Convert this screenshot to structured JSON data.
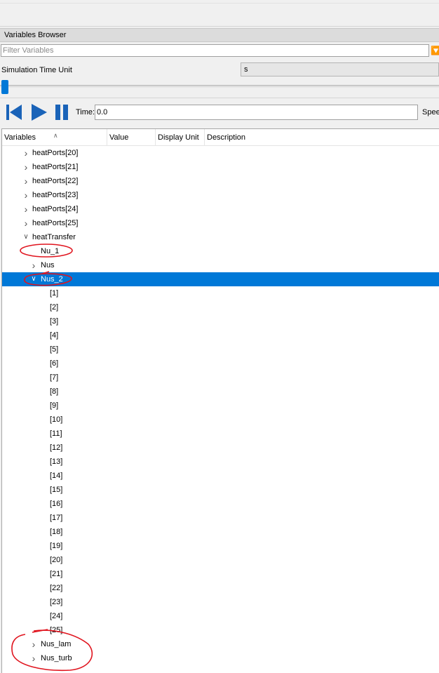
{
  "panel": {
    "title": "Variables Browser"
  },
  "filter": {
    "placeholder": "Filter Variables"
  },
  "sim_time_unit": {
    "label": "Simulation Time Unit",
    "value": "s"
  },
  "toolbar": {
    "time_label": "Time:",
    "time_value": "0.0",
    "speed_label": "Speed"
  },
  "columns": [
    "Variables",
    "Value",
    "Display Unit",
    "Description"
  ],
  "rows": [
    {
      "label": "heatPorts[20]",
      "depth": 1,
      "arrow": "collapsed"
    },
    {
      "label": "heatPorts[21]",
      "depth": 1,
      "arrow": "collapsed"
    },
    {
      "label": "heatPorts[22]",
      "depth": 1,
      "arrow": "collapsed"
    },
    {
      "label": "heatPorts[23]",
      "depth": 1,
      "arrow": "collapsed"
    },
    {
      "label": "heatPorts[24]",
      "depth": 1,
      "arrow": "collapsed"
    },
    {
      "label": "heatPorts[25]",
      "depth": 1,
      "arrow": "collapsed"
    },
    {
      "label": "heatTransfer",
      "depth": 1,
      "arrow": "expanded"
    },
    {
      "label": "Nu_1",
      "depth": 2,
      "arrow": "none"
    },
    {
      "label": "Nus",
      "depth": 2,
      "arrow": "collapsed"
    },
    {
      "label": "Nus_2",
      "depth": 2,
      "arrow": "expanded",
      "selected": true
    },
    {
      "label": "[1]",
      "depth": 3,
      "arrow": "none"
    },
    {
      "label": "[2]",
      "depth": 3,
      "arrow": "none"
    },
    {
      "label": "[3]",
      "depth": 3,
      "arrow": "none"
    },
    {
      "label": "[4]",
      "depth": 3,
      "arrow": "none"
    },
    {
      "label": "[5]",
      "depth": 3,
      "arrow": "none"
    },
    {
      "label": "[6]",
      "depth": 3,
      "arrow": "none"
    },
    {
      "label": "[7]",
      "depth": 3,
      "arrow": "none"
    },
    {
      "label": "[8]",
      "depth": 3,
      "arrow": "none"
    },
    {
      "label": "[9]",
      "depth": 3,
      "arrow": "none"
    },
    {
      "label": "[10]",
      "depth": 3,
      "arrow": "none"
    },
    {
      "label": "[11]",
      "depth": 3,
      "arrow": "none"
    },
    {
      "label": "[12]",
      "depth": 3,
      "arrow": "none"
    },
    {
      "label": "[13]",
      "depth": 3,
      "arrow": "none"
    },
    {
      "label": "[14]",
      "depth": 3,
      "arrow": "none"
    },
    {
      "label": "[15]",
      "depth": 3,
      "arrow": "none"
    },
    {
      "label": "[16]",
      "depth": 3,
      "arrow": "none"
    },
    {
      "label": "[17]",
      "depth": 3,
      "arrow": "none"
    },
    {
      "label": "[18]",
      "depth": 3,
      "arrow": "none"
    },
    {
      "label": "[19]",
      "depth": 3,
      "arrow": "none"
    },
    {
      "label": "[20]",
      "depth": 3,
      "arrow": "none"
    },
    {
      "label": "[21]",
      "depth": 3,
      "arrow": "none"
    },
    {
      "label": "[22]",
      "depth": 3,
      "arrow": "none"
    },
    {
      "label": "[23]",
      "depth": 3,
      "arrow": "none"
    },
    {
      "label": "[24]",
      "depth": 3,
      "arrow": "none"
    },
    {
      "label": "[25]",
      "depth": 3,
      "arrow": "none"
    },
    {
      "label": "Nus_lam",
      "depth": 2,
      "arrow": "collapsed"
    },
    {
      "label": "Nus_turb",
      "depth": 2,
      "arrow": "collapsed"
    }
  ],
  "colors": {
    "accent": "#0078d7",
    "selection": "#0078d7",
    "annotation": "#e0141e",
    "filter_icon": "#e6a400"
  },
  "icons": {
    "filter": "filter-icon",
    "skip_back": "skip-to-start-icon",
    "play": "play-icon",
    "pause": "pause-icon",
    "collapsed": "chevron-right-icon",
    "expanded": "chevron-down-icon"
  }
}
